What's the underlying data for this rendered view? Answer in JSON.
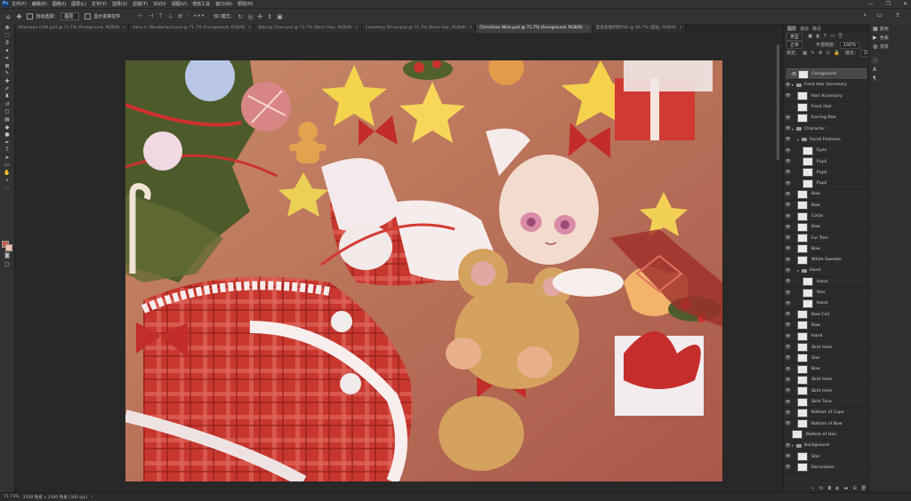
{
  "menu": {
    "logo": "Ps",
    "items": [
      "文件(F)",
      "编辑(E)",
      "图像(I)",
      "图层(L)",
      "文字(Y)",
      "选择(S)",
      "滤镜(T)",
      "3D(D)",
      "视图(V)",
      "增效工具",
      "窗口(W)",
      "帮助(H)"
    ],
    "window_controls": [
      "—",
      "❐",
      "✕"
    ]
  },
  "options": {
    "auto_select_label": "自动选择：",
    "auto_select_value": "图层",
    "transform_label": "显示变换控件",
    "mode_label": "3D 模式："
  },
  "tabs": [
    {
      "label": "Afternoon Café.psd @ 71.7% (Foreground, RGB/8)",
      "active": false
    },
    {
      "label": "Alice in Wonderland.psd @ 71.7% (Foreground, RGB/8)",
      "active": false
    },
    {
      "label": "Baking Class.psd @ 71.7% (Back Hair, RGB/8)",
      "active": false
    },
    {
      "label": "Cemetery Ritual.psd @ 71.7% (Back Hair, RGB/8)",
      "active": false
    },
    {
      "label": "Christmas Wish.psd @ 71.7% (Foreground, RGB/8)",
      "active": true
    },
    {
      "label": "圣诞贺图明暗PSD @ 66.7% (图层, RGB/8)",
      "active": false
    }
  ],
  "panel": {
    "tabs": [
      "图层",
      "通道",
      "路径"
    ],
    "filter_label": "类型",
    "blend_mode": "正常",
    "opacity_label": "不透明度：",
    "opacity_value": "100%",
    "lock_label": "锁定：",
    "fill_label": "填充：",
    "fill_value": "100%"
  },
  "layers": [
    {
      "name": "Foreground",
      "kind": "layer",
      "indent": 0,
      "selected": true,
      "visible": true
    },
    {
      "name": "Front Hair Accessory",
      "kind": "group",
      "indent": 0,
      "selected": false,
      "visible": true
    },
    {
      "name": "Hair Accessory",
      "kind": "layer",
      "indent": 1,
      "selected": false,
      "visible": true
    },
    {
      "name": "Front Hair",
      "kind": "layer",
      "indent": 1,
      "selected": false,
      "visible": false
    },
    {
      "name": "Earring Star",
      "kind": "layer",
      "indent": 1,
      "selected": false,
      "visible": true
    },
    {
      "name": "Character",
      "kind": "group",
      "indent": 0,
      "selected": false,
      "visible": true
    },
    {
      "name": "Facial Features",
      "kind": "group",
      "indent": 1,
      "selected": false,
      "visible": true
    },
    {
      "name": "Eyes",
      "kind": "layer",
      "indent": 2,
      "selected": false,
      "visible": true
    },
    {
      "name": "Pupil",
      "kind": "layer",
      "indent": 2,
      "selected": false,
      "visible": true
    },
    {
      "name": "Pupil",
      "kind": "layer",
      "indent": 2,
      "selected": false,
      "visible": true
    },
    {
      "name": "Pupil",
      "kind": "layer",
      "indent": 2,
      "selected": false,
      "visible": true
    },
    {
      "name": "Bow",
      "kind": "layer",
      "indent": 1,
      "selected": false,
      "visible": true
    },
    {
      "name": "Bow",
      "kind": "layer",
      "indent": 1,
      "selected": false,
      "visible": true
    },
    {
      "name": "Collar",
      "kind": "layer",
      "indent": 1,
      "selected": false,
      "visible": true
    },
    {
      "name": "Bow",
      "kind": "layer",
      "indent": 1,
      "selected": false,
      "visible": true
    },
    {
      "name": "Fur Trim",
      "kind": "layer",
      "indent": 1,
      "selected": false,
      "visible": true
    },
    {
      "name": "Bow",
      "kind": "layer",
      "indent": 1,
      "selected": false,
      "visible": true
    },
    {
      "name": "White Sweater",
      "kind": "layer",
      "indent": 1,
      "selected": false,
      "visible": true
    },
    {
      "name": "Hand",
      "kind": "group",
      "indent": 1,
      "selected": false,
      "visible": true
    },
    {
      "name": "Hand",
      "kind": "layer",
      "indent": 2,
      "selected": false,
      "visible": true
    },
    {
      "name": "Star",
      "kind": "layer",
      "indent": 2,
      "selected": false,
      "visible": true
    },
    {
      "name": "Hand",
      "kind": "layer",
      "indent": 2,
      "selected": false,
      "visible": true
    },
    {
      "name": "Bow Coll",
      "kind": "layer",
      "indent": 1,
      "selected": false,
      "visible": true
    },
    {
      "name": "Bow",
      "kind": "layer",
      "indent": 1,
      "selected": false,
      "visible": true
    },
    {
      "name": "Hand",
      "kind": "layer",
      "indent": 1,
      "selected": false,
      "visible": true
    },
    {
      "name": "Skirt Hem",
      "kind": "layer",
      "indent": 1,
      "selected": false,
      "visible": true
    },
    {
      "name": "Star",
      "kind": "layer",
      "indent": 1,
      "selected": false,
      "visible": true
    },
    {
      "name": "Bow",
      "kind": "layer",
      "indent": 1,
      "selected": false,
      "visible": true
    },
    {
      "name": "Skirt Hem",
      "kind": "layer",
      "indent": 1,
      "selected": false,
      "visible": true
    },
    {
      "name": "Skirt Hem",
      "kind": "layer",
      "indent": 1,
      "selected": false,
      "visible": true
    },
    {
      "name": "Skirt Tone",
      "kind": "layer",
      "indent": 1,
      "selected": false,
      "visible": true
    },
    {
      "name": "Bottom of Cape",
      "kind": "layer",
      "indent": 1,
      "selected": false,
      "visible": true
    },
    {
      "name": "Bottom of Bow",
      "kind": "layer",
      "indent": 1,
      "selected": false,
      "visible": true
    },
    {
      "name": "Bottom of Hair",
      "kind": "layer",
      "indent": 0,
      "selected": false,
      "visible": false
    },
    {
      "name": "Background",
      "kind": "group",
      "indent": 0,
      "selected": false,
      "visible": true
    },
    {
      "name": "Star",
      "kind": "layer",
      "indent": 1,
      "selected": false,
      "visible": true
    },
    {
      "name": "Decoration",
      "kind": "layer",
      "indent": 1,
      "selected": false,
      "visible": true
    }
  ],
  "dock": [
    {
      "icon": "▦",
      "label": "颜色"
    },
    {
      "icon": "▶",
      "label": "色板"
    },
    {
      "icon": "◍",
      "label": "渐变"
    }
  ],
  "status": {
    "zoom": "71.73%",
    "doc_size": "3508 像素 x 2480 像素 (300 ppi)"
  },
  "colors": {
    "foreground": "#c9594a",
    "background": "#f2c3a9"
  }
}
